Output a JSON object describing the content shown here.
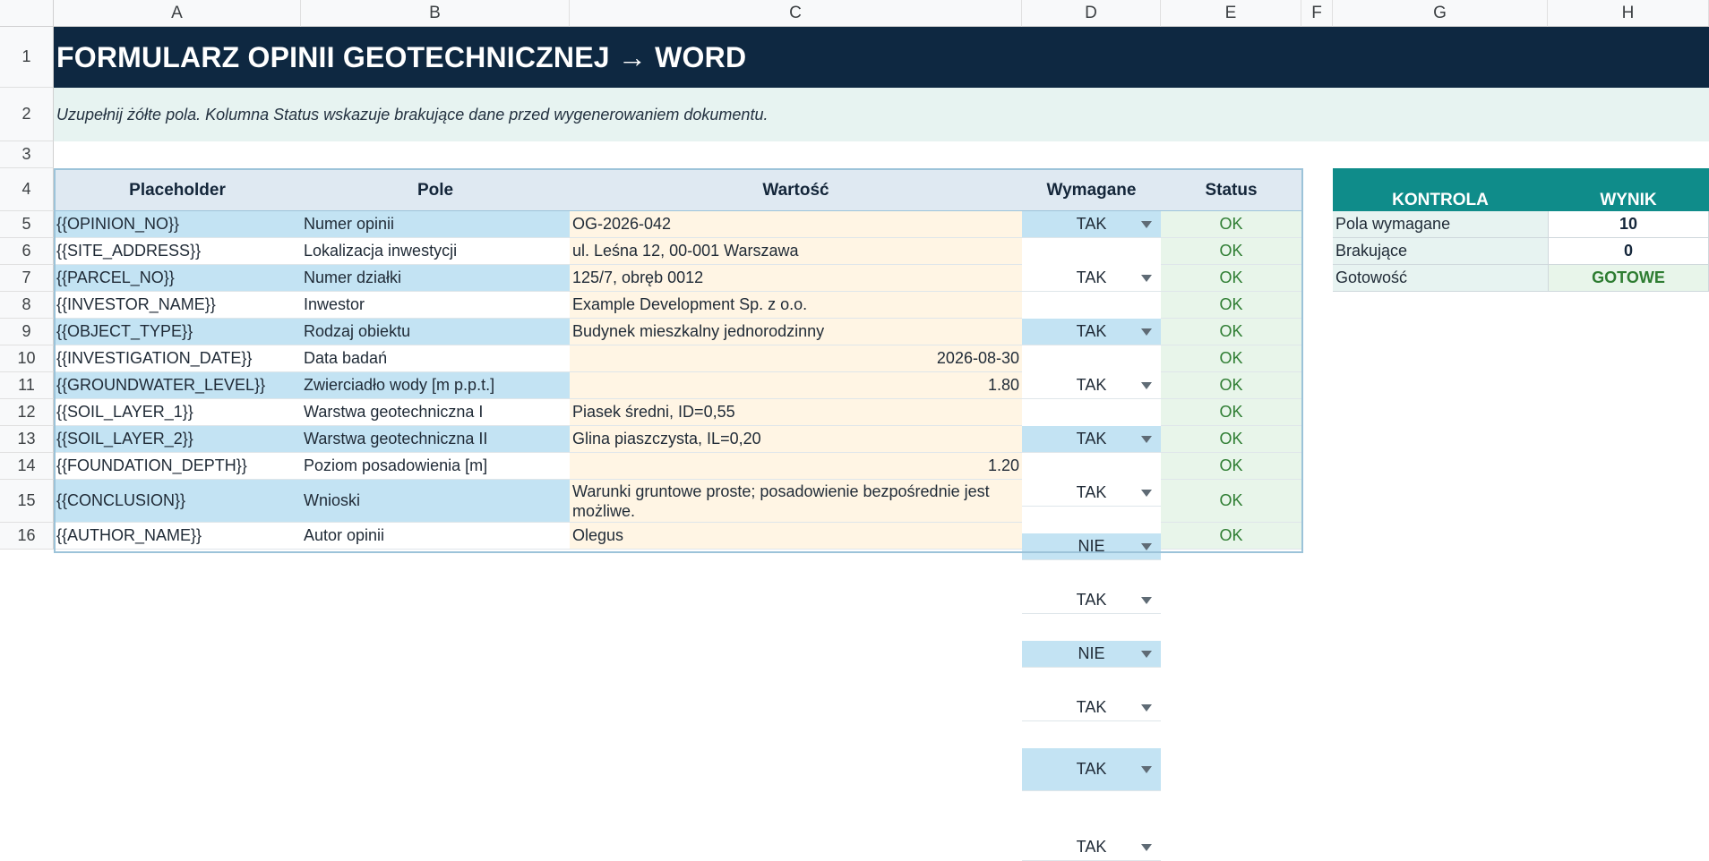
{
  "columns": [
    "A",
    "B",
    "C",
    "D",
    "E",
    "F",
    "G",
    "H"
  ],
  "rows": [
    "1",
    "2",
    "3",
    "4",
    "5",
    "6",
    "7",
    "8",
    "9",
    "10",
    "11",
    "12",
    "13",
    "14",
    "15",
    "16"
  ],
  "title": "FORMULARZ OPINII GEOTECHNICZNEJ → WORD",
  "note": "Uzupełnij żółte pola. Kolumna Status wskazuje brakujące dane przed wygenerowaniem dokumentu.",
  "table": {
    "headers": [
      "Placeholder",
      "Pole",
      "Wartość",
      "Wymagane",
      "Status"
    ],
    "rows": [
      {
        "placeholder": "{{OPINION_NO}}",
        "field": "Numer opinii",
        "value": "OG-2026-042",
        "required": "TAK",
        "status": "OK"
      },
      {
        "placeholder": "{{SITE_ADDRESS}}",
        "field": "Lokalizacja inwestycji",
        "value": "ul. Leśna 12, 00-001 Warszawa",
        "required": "TAK",
        "status": "OK"
      },
      {
        "placeholder": "{{PARCEL_NO}}",
        "field": "Numer działki",
        "value": "125/7, obręb 0012",
        "required": "TAK",
        "status": "OK"
      },
      {
        "placeholder": "{{INVESTOR_NAME}}",
        "field": "Inwestor",
        "value": "Example Development Sp. z o.o.",
        "required": "TAK",
        "status": "OK"
      },
      {
        "placeholder": "{{OBJECT_TYPE}}",
        "field": "Rodzaj obiektu",
        "value": "Budynek mieszkalny jednorodzinny",
        "required": "TAK",
        "status": "OK"
      },
      {
        "placeholder": "{{INVESTIGATION_DATE}}",
        "field": "Data badań",
        "value": "2026-08-30",
        "required": "TAK",
        "status": "OK"
      },
      {
        "placeholder": "{{GROUNDWATER_LEVEL}}",
        "field": "Zwierciadło wody [m p.p.t.]",
        "value": "1.80",
        "required": "NIE",
        "status": "OK"
      },
      {
        "placeholder": "{{SOIL_LAYER_1}}",
        "field": "Warstwa geotechniczna I",
        "value": "Piasek średni, ID=0,55",
        "required": "TAK",
        "status": "OK"
      },
      {
        "placeholder": "{{SOIL_LAYER_2}}",
        "field": "Warstwa geotechniczna II",
        "value": "Glina piaszczysta, IL=0,20",
        "required": "NIE",
        "status": "OK"
      },
      {
        "placeholder": "{{FOUNDATION_DEPTH}}",
        "field": "Poziom posadowienia [m]",
        "value": "1.20",
        "required": "TAK",
        "status": "OK"
      },
      {
        "placeholder": "{{CONCLUSION}}",
        "field": "Wnioski",
        "value": "Warunki gruntowe proste; posadowienie bezpośrednie jest możliwe.",
        "required": "TAK",
        "status": "OK"
      },
      {
        "placeholder": "{{AUTHOR_NAME}}",
        "field": "Autor opinii",
        "value": "Olegus",
        "required": "TAK",
        "status": "OK"
      }
    ]
  },
  "control": {
    "headers": [
      "KONTROLA",
      "WYNIK"
    ],
    "rows": [
      {
        "label": "Pola wymagane",
        "value": "10"
      },
      {
        "label": "Brakujące",
        "value": "0"
      },
      {
        "label": "Gotowość",
        "value": "GOTOWE"
      }
    ]
  },
  "colors": {
    "title_bg": "#0e2841",
    "note_bg": "#e7f3f1",
    "header_bg": "#dfe9f2",
    "placeholder_bg": "#c3e3f3",
    "input_bg": "#fff5e4",
    "ok_bg": "#e8f5ea",
    "ok_text": "#2e7d32",
    "control_header_bg": "#0f8c8a"
  },
  "icons": {
    "dropdown": "dropdown-arrow-icon"
  }
}
